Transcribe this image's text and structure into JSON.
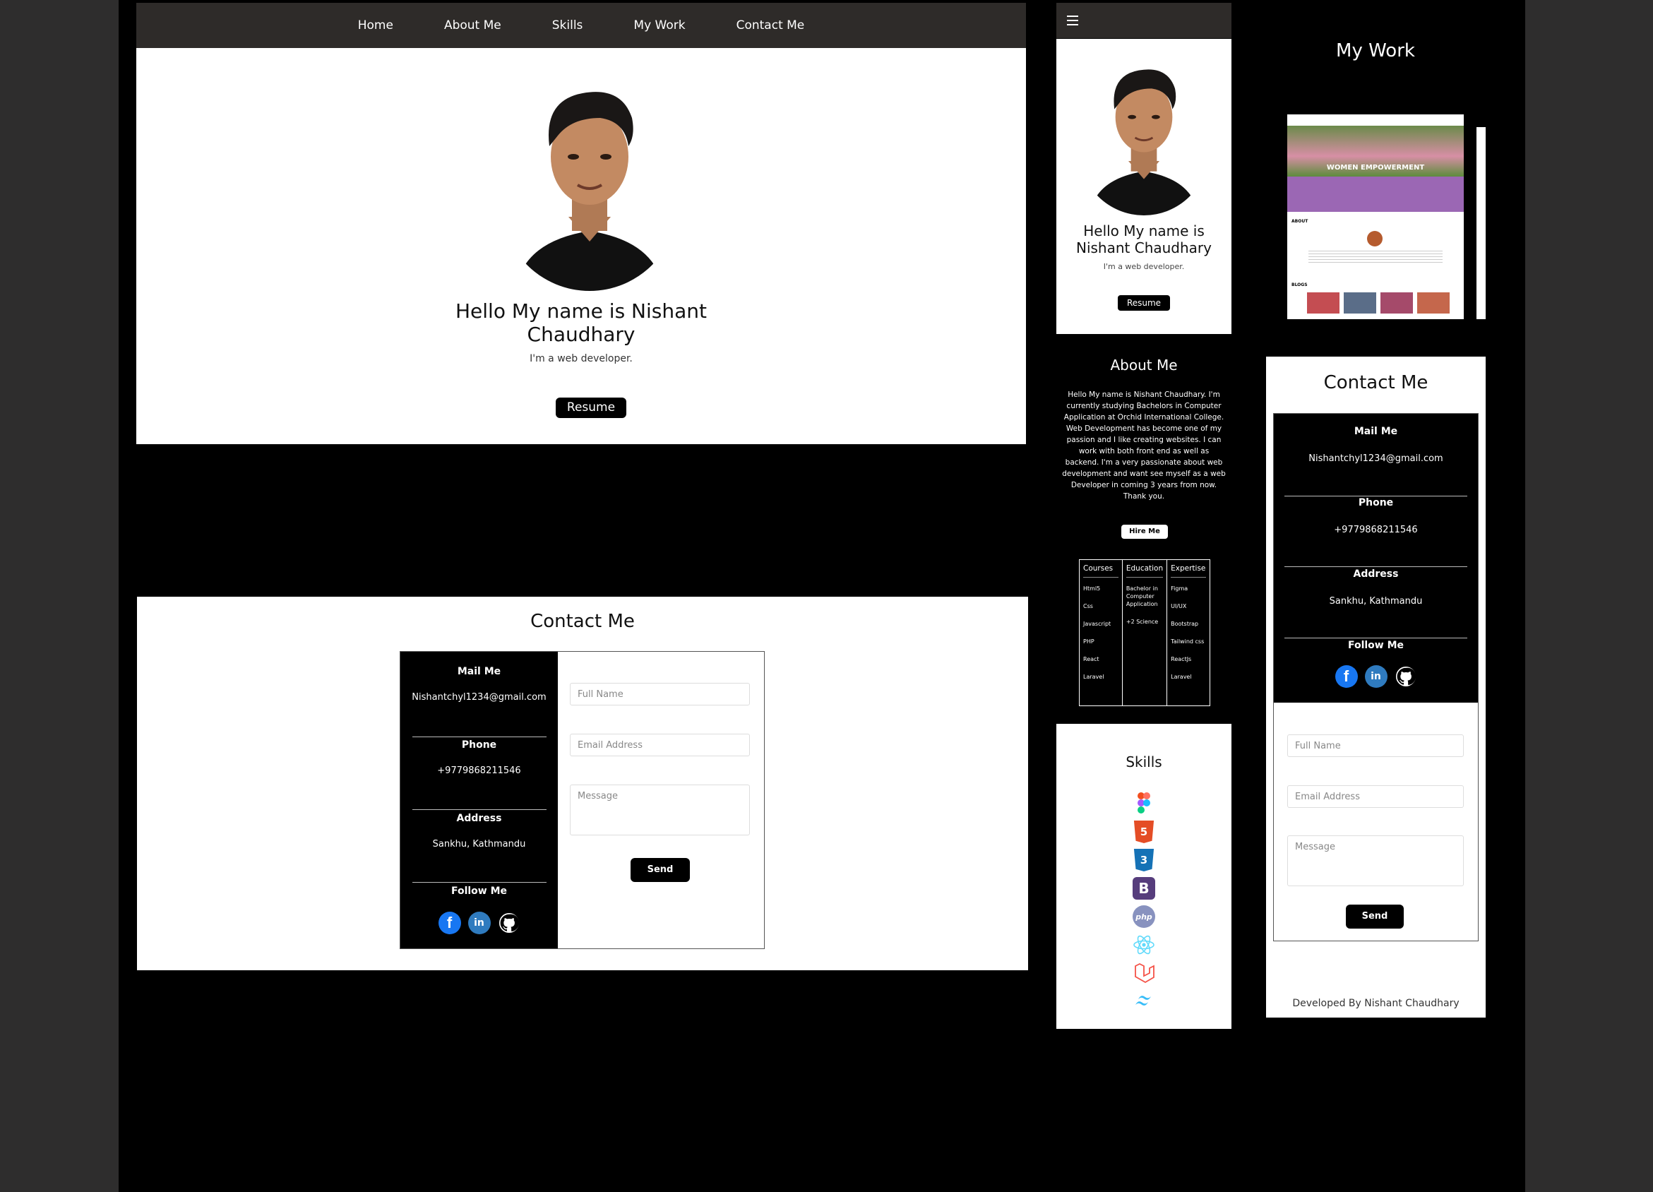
{
  "desktop": {
    "nav": [
      "Home",
      "About Me",
      "Skills",
      "My Work",
      "Contact Me"
    ],
    "hero": {
      "greeting": "Hello My name is Nishant Chaudhary",
      "role": "I'm a web developer.",
      "resume_label": "Resume"
    },
    "contact": {
      "title": "Contact Me",
      "mail_heading": "Mail Me",
      "mail_value": "Nishantchyl1234@gmail.com",
      "phone_heading": "Phone",
      "phone_value": "+9779868211546",
      "address_heading": "Address",
      "address_value": "Sankhu, Kathmandu",
      "follow_heading": "Follow Me",
      "name_placeholder": "Full Name",
      "email_placeholder": "Email Address",
      "message_placeholder": "Message",
      "send_label": "Send"
    }
  },
  "mobile": {
    "menu_icon": "hamburger-icon",
    "hero": {
      "greeting": "Hello My name is Nishant Chaudhary",
      "role": "I'm a web developer.",
      "resume_label": "Resume"
    },
    "about": {
      "title": "About Me",
      "text": "Hello My name is Nishant Chaudhary. I'm currently studying Bachelors in Computer Application at Orchid International College. Web Development has become one of my passion and I like creating websites. I can work with both front end as well as backend. I'm a very passionate about web development and want see myself as a web Developer in coming 3 years from now. Thank you.",
      "hire_label": "Hire Me",
      "table": {
        "courses_heading": "Courses",
        "courses": [
          "Html5",
          "Css",
          "Javascript",
          "PHP",
          "React",
          "Laravel"
        ],
        "education_heading": "Education",
        "education": [
          "Bachelor in Computer Application",
          "+2 Science"
        ],
        "expertise_heading": "Expertise",
        "expertise": [
          "Figma",
          "UI/UX",
          "Bootstrap",
          "Tailwind css",
          "ReactJs",
          "Laravel"
        ]
      }
    },
    "skills": {
      "title": "Skills",
      "icons": [
        "figma-icon",
        "html5-icon",
        "css3-icon",
        "bootstrap-icon",
        "php-icon",
        "react-icon",
        "laravel-icon",
        "tailwind-icon"
      ]
    },
    "work": {
      "title": "My Work",
      "preview_banner": "WOMEN EMPOWERMENT",
      "preview_about": "ABOUT",
      "preview_blogs": "BLOGS"
    },
    "contact": {
      "title": "Contact Me",
      "mail_heading": "Mail Me",
      "mail_value": "Nishantchyl1234@gmail.com",
      "phone_heading": "Phone",
      "phone_value": "+9779868211546",
      "address_heading": "Address",
      "address_value": "Sankhu, Kathmandu",
      "follow_heading": "Follow Me",
      "name_placeholder": "Full Name",
      "email_placeholder": "Email Address",
      "message_placeholder": "Message",
      "send_label": "Send"
    },
    "footer": "Developed By Nishant Chaudhary"
  },
  "colors": {
    "page_bg": "#000000",
    "nav_bg": "#2e2b29",
    "facebook": "#1877f2",
    "linkedin": "#2f7bbf"
  }
}
